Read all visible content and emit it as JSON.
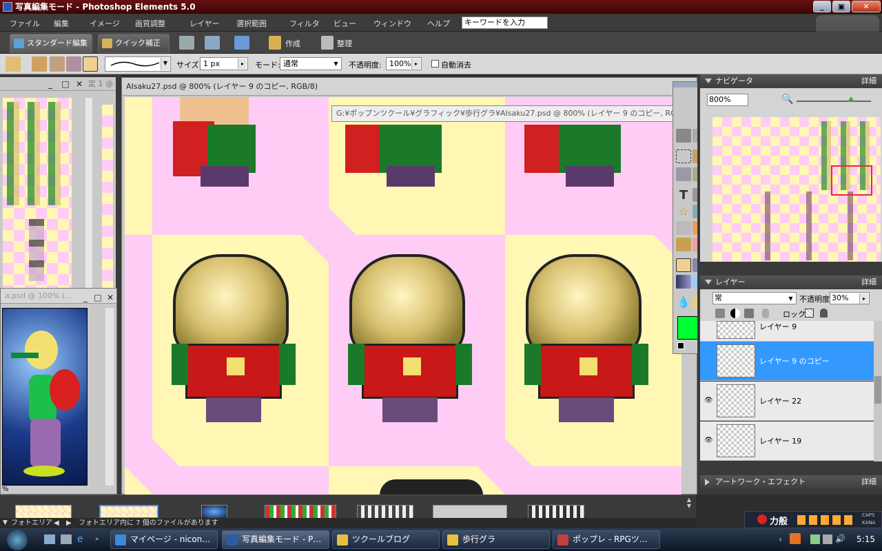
{
  "titlebar": {
    "title": "写真編集モード - Photoshop Elements 5.0",
    "minimize": "_",
    "maximize": "▣",
    "close": "✕"
  },
  "menu": {
    "items": [
      "ファイル",
      "編集",
      "イメージ",
      "画質調整",
      "レイヤー",
      "選択範囲",
      "フィルタ",
      "ビュー",
      "ウィンドウ",
      "ヘルプ"
    ],
    "search_placeholder": "キーワードを入力"
  },
  "modebar": {
    "tab_standard": "スタンダード編集",
    "tab_quick": "クイック補正",
    "create": "作成",
    "organize": "整理"
  },
  "options": {
    "size_label": "サイズ:",
    "size_value": "1 px",
    "mode_label": "モード:",
    "mode_value": "通常",
    "opacity_label": "不透明度:",
    "opacity_value": "100%",
    "auto_erase": "自動消去"
  },
  "document": {
    "title": "AIsaku27.psd @ 800% (レイヤー 9 のコピー, RGB/8)",
    "tooltip": "G:¥ポップンツクール¥グラフィック¥歩行グラ¥AIsaku27.psd @ 800% (レイヤー 9 のコピー, RGB/8)"
  },
  "left_doc": {
    "title": "定 1 @"
  },
  "small_doc": {
    "title": "a.psd @ 100% (…",
    "zoom": "%"
  },
  "navigator": {
    "title": "ナビゲータ",
    "more": "詳細",
    "zoom": "800%"
  },
  "layers": {
    "title": "レイヤー",
    "more": "詳細",
    "blend_mode": "常",
    "opacity_label": "不透明度:",
    "opacity_value": "30%",
    "lock_label": "ロック:",
    "rows": [
      {
        "name": "レイヤー 9 のコピー",
        "selected": true
      },
      {
        "name": "レイヤー 22",
        "selected": false
      },
      {
        "name": "レイヤー 19",
        "selected": false
      }
    ],
    "partial_row": "レイヤー 9"
  },
  "artwork": {
    "title": "アートワーク・エフェクト",
    "more": "詳細"
  },
  "bin": {
    "label": "フォトエリア",
    "status": "フォトエリア内に 7 個のファイルがあります"
  },
  "taskbar": {
    "tasks": [
      "マイページ - nicon…",
      "写真編集モード - P…",
      "ツクールブログ",
      "歩行グラ",
      "ポップレ - RPGツ…"
    ],
    "tray_ime": "力般",
    "clock": "5:15",
    "caps": "CAPS",
    "kana": "KANA"
  },
  "colors": {
    "foreground": "#00ff33",
    "selection": "#3399ff",
    "accent": "#6a1010"
  }
}
